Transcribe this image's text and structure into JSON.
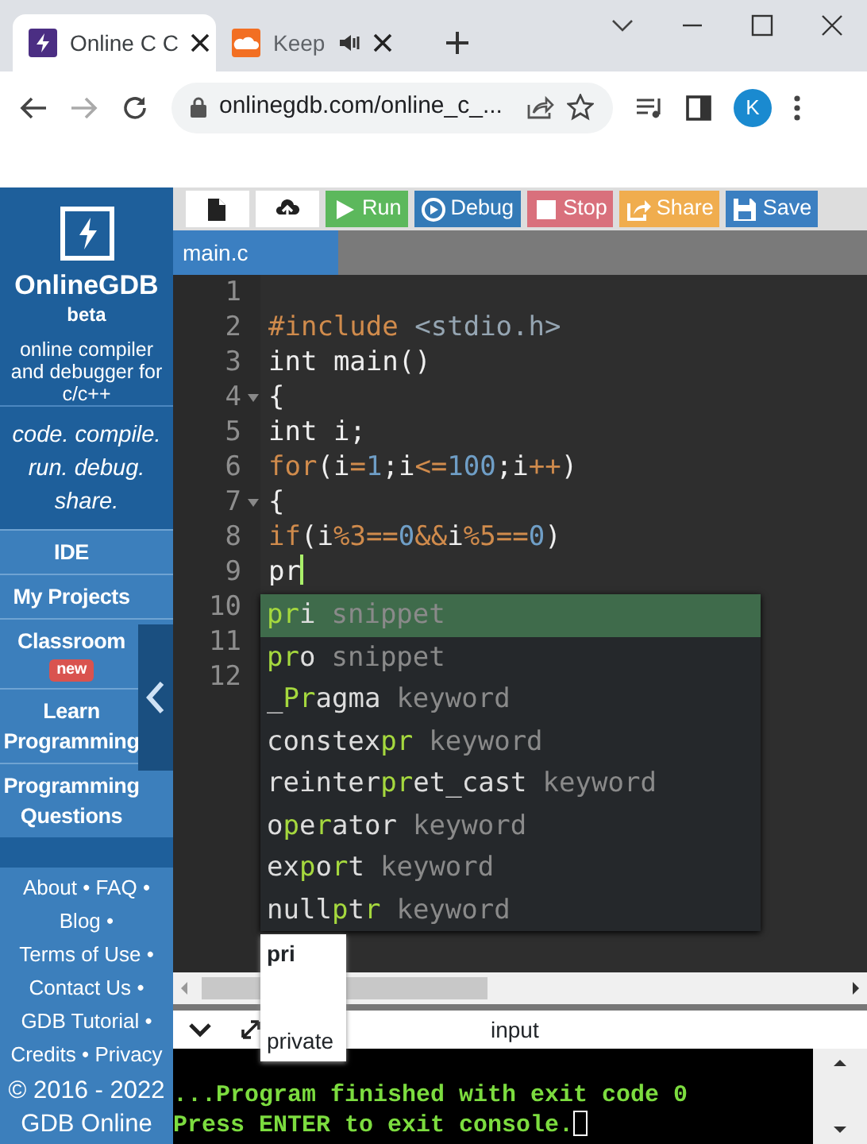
{
  "browser": {
    "tabs": [
      {
        "title": "Online C C",
        "selected": true,
        "audio": false
      },
      {
        "title": "Keep",
        "selected": false,
        "audio": true
      }
    ],
    "address": "onlinegdb.com/online_c_...",
    "avatar": "K"
  },
  "sidebar": {
    "brand": "OnlineGDB",
    "edition": "beta",
    "tagline": "online compiler and debugger for c/c++",
    "motto": "code. compile. run. debug. share.",
    "menu": [
      {
        "label": "IDE"
      },
      {
        "label": "My Projects"
      },
      {
        "label": "Classroom",
        "badge": "new"
      },
      {
        "label": "Learn Programming"
      },
      {
        "label": "Programming Questions"
      }
    ],
    "footer_links": [
      "About",
      "FAQ",
      "Blog",
      "Terms of Use",
      "Contact Us",
      "GDB Tutorial",
      "Credits",
      "Privacy"
    ],
    "footer_separator": "•",
    "copyright": "© 2016 - 2022 GDB Online"
  },
  "toolbar": {
    "buttons": [
      {
        "kind": "new-file"
      },
      {
        "kind": "upload"
      },
      {
        "kind": "run",
        "label": "Run"
      },
      {
        "kind": "debug",
        "label": "Debug"
      },
      {
        "kind": "stop",
        "label": "Stop"
      },
      {
        "kind": "share",
        "label": "Share"
      },
      {
        "kind": "save",
        "label": "Save"
      }
    ]
  },
  "file_tabs": [
    {
      "label": "main.c",
      "selected": true
    }
  ],
  "editor": {
    "lines": [
      {
        "number": "1",
        "fold": false,
        "cursor": false
      },
      {
        "number": "2",
        "fold": false,
        "cursor": false,
        "tokens": [
          {
            "kind": "keyword",
            "text": "#include"
          },
          {
            "kind": "header",
            "text": " <stdio.h>"
          }
        ]
      },
      {
        "number": "3",
        "fold": false,
        "cursor": false,
        "tokens": [
          {
            "kind": "plain",
            "text": "int main()"
          }
        ]
      },
      {
        "number": "4",
        "fold": true,
        "cursor": false,
        "tokens": [
          {
            "kind": "plain",
            "text": "{"
          }
        ]
      },
      {
        "number": "5",
        "fold": false,
        "cursor": false,
        "tokens": [
          {
            "kind": "plain",
            "text": "int i;"
          }
        ]
      },
      {
        "number": "6",
        "fold": false,
        "cursor": false,
        "tokens": [
          {
            "kind": "keyword",
            "text": "for"
          },
          {
            "kind": "plain",
            "text": "(i"
          },
          {
            "kind": "operator",
            "text": "="
          },
          {
            "kind": "number",
            "text": "1"
          },
          {
            "kind": "plain",
            "text": ";i"
          },
          {
            "kind": "operator",
            "text": "<="
          },
          {
            "kind": "number",
            "text": "100"
          },
          {
            "kind": "plain",
            "text": ";i"
          },
          {
            "kind": "operator",
            "text": "++"
          },
          {
            "kind": "plain",
            "text": ")"
          }
        ]
      },
      {
        "number": "7",
        "fold": true,
        "cursor": false,
        "tokens": [
          {
            "kind": "plain",
            "text": "{"
          }
        ]
      },
      {
        "number": "8",
        "fold": false,
        "cursor": false,
        "tokens": [
          {
            "kind": "keyword",
            "text": "if"
          },
          {
            "kind": "plain",
            "text": "(i"
          },
          {
            "kind": "operator",
            "text": "%3=="
          },
          {
            "kind": "number",
            "text": "0"
          },
          {
            "kind": "operator",
            "text": "&&"
          },
          {
            "kind": "plain",
            "text": "i"
          },
          {
            "kind": "operator",
            "text": "%5=="
          },
          {
            "kind": "number",
            "text": "0"
          },
          {
            "kind": "plain",
            "text": ")"
          }
        ]
      },
      {
        "number": "9",
        "fold": false,
        "cursor": true,
        "tokens": [
          {
            "kind": "plain",
            "text": "pr"
          }
        ]
      },
      {
        "number": "10",
        "fold": false,
        "cursor": false
      },
      {
        "number": "11",
        "fold": false,
        "cursor": false
      },
      {
        "number": "12",
        "fold": false,
        "cursor": false
      }
    ]
  },
  "autocomplete": {
    "items": [
      {
        "selected": true,
        "meta": "snippet",
        "parts": [
          {
            "text": "pr",
            "match": true
          },
          {
            "text": "i",
            "match": false
          }
        ]
      },
      {
        "selected": false,
        "meta": "snippet",
        "parts": [
          {
            "text": "pr",
            "match": true
          },
          {
            "text": "o",
            "match": false
          }
        ]
      },
      {
        "selected": false,
        "meta": "keyword",
        "parts": [
          {
            "text": "_",
            "match": false
          },
          {
            "text": "Pr",
            "match": true
          },
          {
            "text": "agma",
            "match": false
          }
        ]
      },
      {
        "selected": false,
        "meta": "keyword",
        "parts": [
          {
            "text": "constex",
            "match": false
          },
          {
            "text": "pr",
            "match": true
          }
        ]
      },
      {
        "selected": false,
        "meta": "keyword",
        "parts": [
          {
            "text": "reinter",
            "match": false
          },
          {
            "text": "pr",
            "match": true
          },
          {
            "text": "et_cast",
            "match": false
          }
        ]
      },
      {
        "selected": false,
        "meta": "keyword",
        "parts": [
          {
            "text": "o",
            "match": false
          },
          {
            "text": "p",
            "match": true
          },
          {
            "text": "e",
            "match": false
          },
          {
            "text": "r",
            "match": true
          },
          {
            "text": "ator",
            "match": false
          }
        ]
      },
      {
        "selected": false,
        "meta": "keyword",
        "parts": [
          {
            "text": "ex",
            "match": false
          },
          {
            "text": "p",
            "match": true
          },
          {
            "text": "o",
            "match": false
          },
          {
            "text": "r",
            "match": true
          },
          {
            "text": "t",
            "match": false
          }
        ]
      },
      {
        "selected": false,
        "meta": "keyword",
        "parts": [
          {
            "text": "null",
            "match": false
          },
          {
            "text": "p",
            "match": true
          },
          {
            "text": "t",
            "match": false
          },
          {
            "text": "r",
            "match": true
          }
        ]
      }
    ]
  },
  "doc_tooltip": {
    "name": "pri",
    "detail": "private"
  },
  "console": {
    "header": "input",
    "output": [
      "...Program finished with exit code 0",
      "Press ENTER to exit console."
    ]
  }
}
